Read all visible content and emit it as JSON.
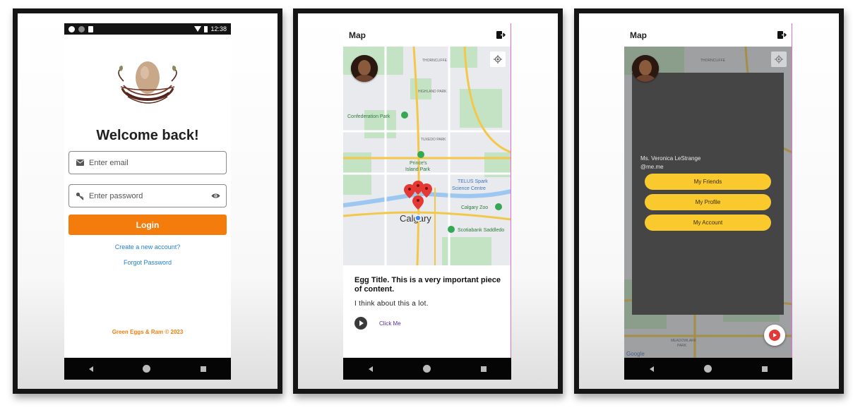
{
  "login": {
    "status_time": "12:38",
    "welcome": "Welcome back!",
    "email_placeholder": "Enter email",
    "password_placeholder": "Enter password",
    "login_label": "Login",
    "create_account": "Create a new account?",
    "forgot_password": "Forgot Password",
    "footer": "Green Eggs & Ram © 2023"
  },
  "map": {
    "title": "Map",
    "labels": {
      "thorncliffe": "THORNCLIFFE",
      "highland": "HIGHLAND PARK",
      "confederation": "Confederation Park",
      "tuxedo": "TUXEDO PARK",
      "princes": "Prince's",
      "island": "Island Park",
      "telus": "TELUS Spark",
      "science": "Science Centre",
      "zoo": "Calgary Zoo",
      "calgary": "Calgary",
      "scotiabank": "Scotiabank Saddledo",
      "meadowlark": "MEADOWLARK",
      "park": "PARK",
      "google": "Google"
    },
    "card": {
      "title": "Egg Title. This is a very important piece of content.",
      "description": "I think about this a lot.",
      "action": "Click Me"
    }
  },
  "drawer": {
    "name": "Ms. Veronica LeStrange",
    "handle": "@me.me",
    "buttons": [
      "My Friends",
      "My Profile",
      "My Account"
    ]
  },
  "colors": {
    "primary": "#f37c0c",
    "link": "#1f7fd0",
    "menu_button": "#f9c92e",
    "drawer": "#454545"
  }
}
